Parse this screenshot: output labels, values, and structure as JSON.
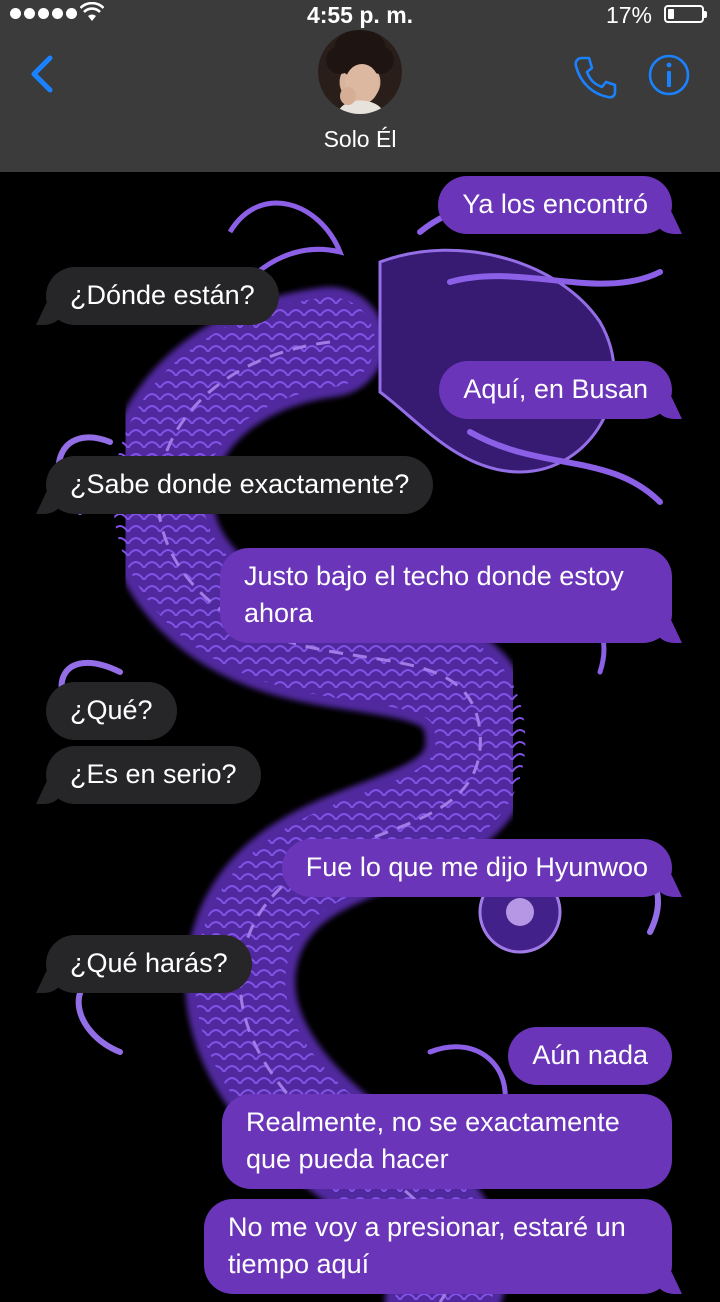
{
  "status_bar": {
    "time": "4:55 p. m.",
    "battery_percent_label": "17%",
    "battery_level": 0.17,
    "signal_bars": 5
  },
  "header": {
    "contact_name": "Solo Él",
    "back_icon": "chevron-left-icon",
    "call_icon": "phone-icon",
    "info_icon": "info-icon"
  },
  "colors": {
    "outgoing_bubble": "#6a35b8",
    "incoming_bubble": "#262628",
    "header_bg": "#3b3b3b",
    "accent": "#1a82ff",
    "dragon": "#9b6bff"
  },
  "messages": [
    {
      "side": "out",
      "text": "Ya los encontró"
    },
    {
      "side": "in",
      "text": "¿Dónde están?"
    },
    {
      "side": "out",
      "text": "Aquí, en Busan"
    },
    {
      "side": "in",
      "text": "¿Sabe donde exactamente?"
    },
    {
      "side": "out",
      "text": "Justo bajo el techo donde estoy ahora"
    },
    {
      "side": "in",
      "text": "¿Qué?"
    },
    {
      "side": "in",
      "text": "¿Es en serio?"
    },
    {
      "side": "out",
      "text": "Fue lo que me dijo Hyunwoo"
    },
    {
      "side": "in",
      "text": "¿Qué harás?"
    },
    {
      "side": "out",
      "text": "Aún nada"
    },
    {
      "side": "out",
      "text": "Realmente, no se exactamente que pueda hacer"
    },
    {
      "side": "out",
      "text": "No me voy a presionar, estaré un tiempo aquí"
    }
  ]
}
